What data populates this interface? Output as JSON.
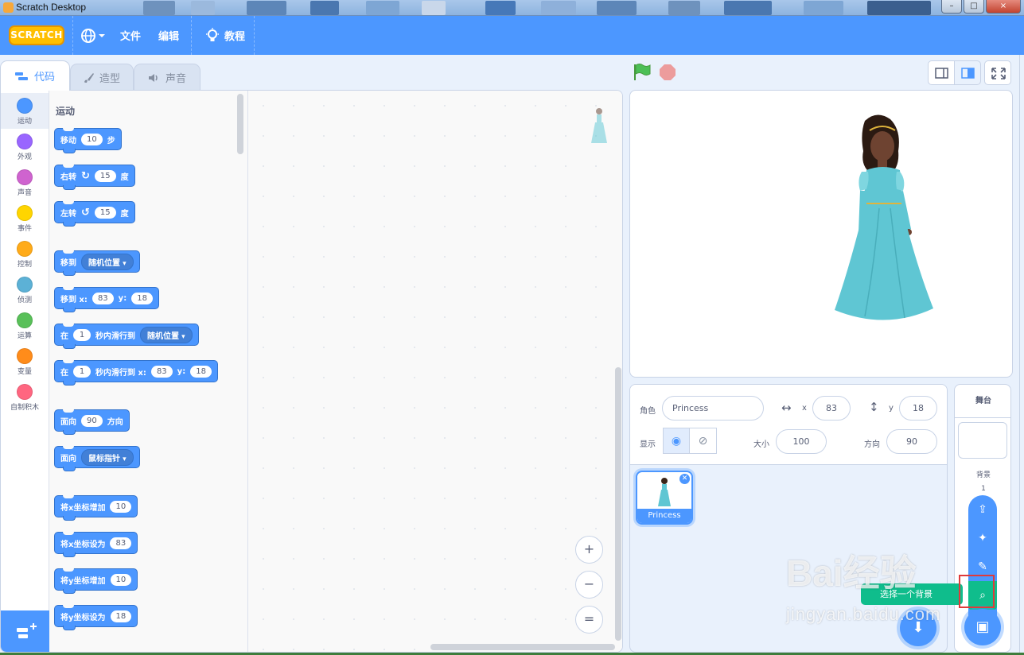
{
  "window": {
    "title": "Scratch Desktop",
    "buttons": [
      "–",
      "□",
      "×"
    ]
  },
  "menubar": {
    "logo": "SCRATCH",
    "language_icon": "globe-icon",
    "file": "文件",
    "edit": "编辑",
    "tutorials": "教程"
  },
  "tabs": [
    {
      "label": "代码",
      "icon": "code-icon"
    },
    {
      "label": "造型",
      "icon": "brush-icon"
    },
    {
      "label": "声音",
      "icon": "speaker-icon"
    }
  ],
  "categories": [
    {
      "label": "运动",
      "color": "#4c97ff"
    },
    {
      "label": "外观",
      "color": "#9966ff"
    },
    {
      "label": "声音",
      "color": "#cf63cf"
    },
    {
      "label": "事件",
      "color": "#ffd500"
    },
    {
      "label": "控制",
      "color": "#ffab19"
    },
    {
      "label": "侦测",
      "color": "#5cb1d6"
    },
    {
      "label": "运算",
      "color": "#59c059"
    },
    {
      "label": "变量",
      "color": "#ff8c1a"
    },
    {
      "label": "自制积木",
      "color": "#ff6680"
    }
  ],
  "palette": {
    "section_title": "运动",
    "move": {
      "label": "移动",
      "steps": "10",
      "unit": "步"
    },
    "turn_right": {
      "label": "右转",
      "degrees": "15",
      "unit": "度"
    },
    "turn_left": {
      "label": "左转",
      "degrees": "15",
      "unit": "度"
    },
    "goto": {
      "label": "移到",
      "target": "随机位置"
    },
    "goto_xy": {
      "label": "移到 x:",
      "x": "83",
      "ylabel": "y:",
      "y": "18"
    },
    "glide": {
      "label": "在",
      "secs": "1",
      "mid": "秒内滑行到",
      "target": "随机位置"
    },
    "glide_xy": {
      "label": "在",
      "secs": "1",
      "mid": "秒内滑行到 x:",
      "x": "83",
      "ylabel": "y:",
      "y": "18"
    },
    "point_dir": {
      "label": "面向",
      "value": "90",
      "unit": "方向"
    },
    "point_towards": {
      "label": "面向",
      "target": "鼠标指针"
    },
    "change_x": {
      "label": "将x坐标增加",
      "value": "10"
    },
    "set_x": {
      "label": "将x坐标设为",
      "value": "83"
    },
    "change_y": {
      "label": "将y坐标增加",
      "value": "10"
    },
    "set_y": {
      "label": "将y坐标设为",
      "value": "18"
    }
  },
  "zoom": {
    "in": "+",
    "out": "−",
    "reset": "="
  },
  "sprite_info": {
    "sprite_label": "角色",
    "sprite_name": "Princess",
    "x_label": "x",
    "x": "83",
    "y_label": "y",
    "y": "18",
    "show_label": "显示",
    "size_label": "大小",
    "size": "100",
    "direction_label": "方向",
    "direction": "90"
  },
  "sprites": [
    {
      "name": "Princess"
    }
  ],
  "stage_panel": {
    "title": "舞台",
    "backdrops_label": "背景",
    "backdrop_count": "1"
  },
  "tooltip": "选择一个背景",
  "watermark": {
    "line1": "Bai经验",
    "line2": "jingyan.baidu.com"
  },
  "colors": {
    "brand": "#4c97ff",
    "motion": "#4c97ff",
    "highlight": "#e03a3a",
    "tooltip": "#0fbd8c"
  }
}
